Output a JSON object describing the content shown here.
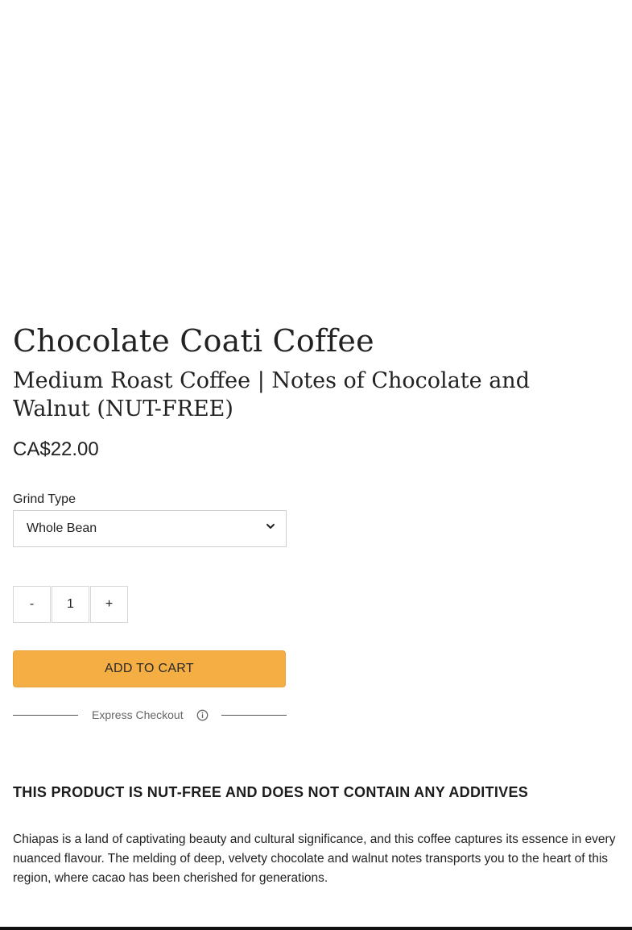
{
  "product": {
    "title": "Chocolate Coati Coffee",
    "subtitle": "Medium Roast Coffee | Notes of Chocolate and Walnut (NUT-FREE)",
    "price": "CA$22.00"
  },
  "grind": {
    "label": "Grind Type",
    "selected": "Whole Bean"
  },
  "quantity": {
    "minus": "-",
    "value": "1",
    "plus": "+"
  },
  "cart": {
    "add_label": "ADD TO CART"
  },
  "express": {
    "label": "Express Checkout"
  },
  "description": {
    "headline": "THIS PRODUCT IS NUT-FREE AND DOES NOT CONTAIN ANY ADDITIVES",
    "body": "Chiapas is a land of captivating beauty and cultural significance, and this coffee captures its essence in every nuanced flavour. The melding of deep, velvety chocolate and walnut notes transports you to the heart of this region, where cacao has been cherished for generations."
  },
  "colors": {
    "accent": "#f5ae43",
    "text": "#222222"
  },
  "icons": {
    "select": "chevron-down-icon",
    "express": "info-icon"
  }
}
